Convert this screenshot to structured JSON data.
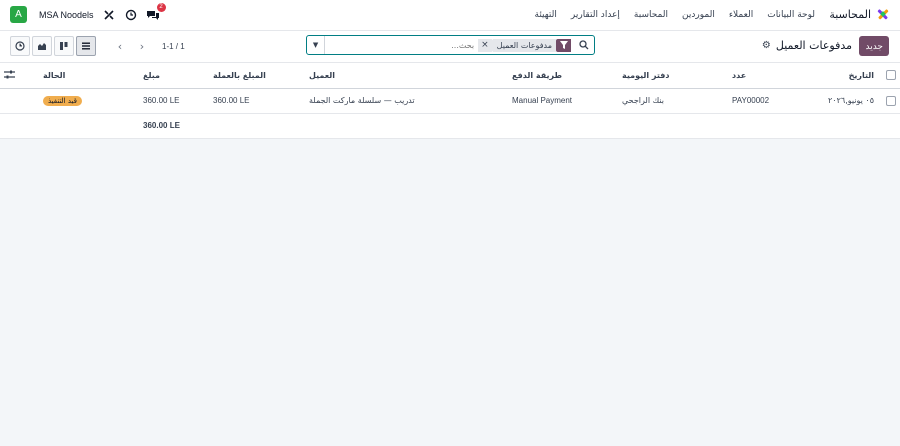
{
  "navbar": {
    "app_name": "المحاسبة",
    "menu": [
      "لوحة البيانات",
      "العملاء",
      "الموردين",
      "المحاسبة",
      "إعداد التقارير",
      "التهيئة"
    ],
    "company": "MSA Noodels",
    "avatar_letter": "A",
    "chat_badge": "2",
    "icons": [
      "debug-icon",
      "clock-icon",
      "chat-icon"
    ]
  },
  "control": {
    "new_label": "جديد",
    "breadcrumb": "مدفوعات العميل",
    "search": {
      "facet_label": "مدفوعات العميل",
      "placeholder": "بحث..."
    },
    "pager": "1-1 / 1",
    "views": [
      "list-view",
      "kanban-view",
      "graph-view",
      "activity-view"
    ]
  },
  "table": {
    "columns": [
      "التاريخ",
      "عدد",
      "دفتر اليومية",
      "طريقة الدفع",
      "العميل",
      "المبلغ بالعملة",
      "مبلغ",
      "الحالة"
    ],
    "rows": [
      {
        "date": "٠٥ يونيو,٢٠٢٦",
        "number": "PAY00002",
        "journal": "بنك الراجحي",
        "method": "Manual Payment",
        "customer": "تدريب — سلسلة ماركت الجملة",
        "amount_currency": "360.00 LE",
        "amount": "360.00 LE",
        "status": "قيد التنفيذ"
      }
    ],
    "total": "360.00 LE"
  },
  "colors": {
    "primary": "#714b67",
    "teal": "#017e84",
    "status_warning": "#f0ad4e",
    "avatar": "#28a745"
  }
}
